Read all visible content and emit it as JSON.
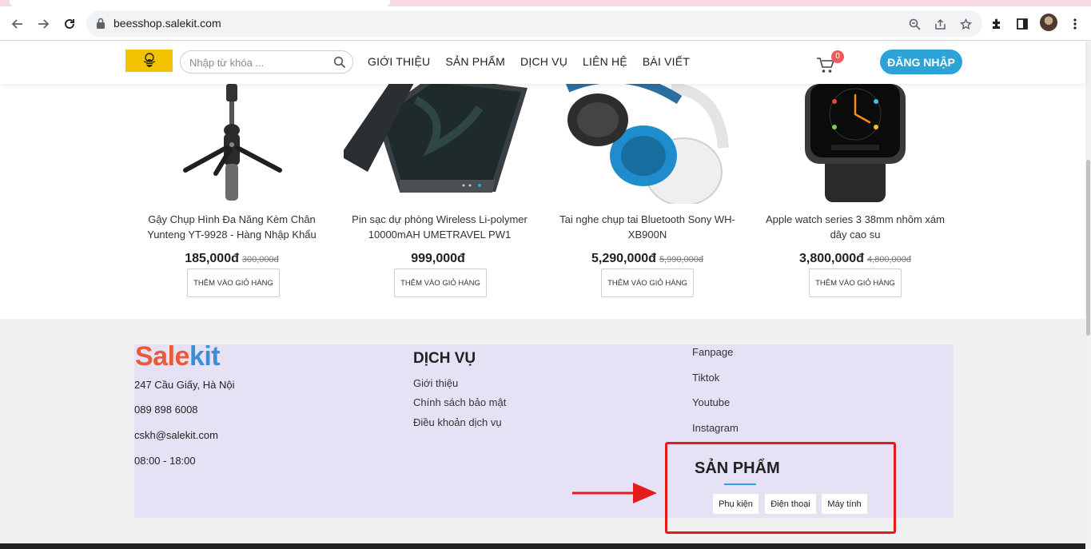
{
  "browser": {
    "url": "beesshop.salekit.com",
    "icons": [
      "back-icon",
      "forward-icon",
      "reload-icon",
      "lock-icon",
      "zoom-icon",
      "share-icon",
      "star-icon",
      "extensions-icon",
      "sidepanel-icon",
      "profile-avatar",
      "more-icon"
    ]
  },
  "header": {
    "search_placeholder": "Nhập từ khóa ...",
    "menu": [
      "GIỚI THIỆU",
      "SẢN PHẨM",
      "DỊCH VỤ",
      "LIÊN HỆ",
      "BÀI VIẾT"
    ],
    "cart_count": "0",
    "login_label": "ĐĂNG NHẬP",
    "colors": {
      "logo_bg": "#f3c200",
      "accent": "#2ba3d6",
      "badge": "#ef5b5b"
    }
  },
  "products": [
    {
      "name": "Gậy Chụp Hình Đa Năng Kèm Chân Yunteng YT-9928 - Hàng Nhập Khẩu",
      "price": "185,000đ",
      "old_price": "300,000đ",
      "button": "THÊM VÀO GIỎ HÀNG"
    },
    {
      "name": "Pin sạc dự phòng Wireless Li-polymer 10000mAH UMETRAVEL PW1",
      "price": "999,000đ",
      "old_price": "",
      "button": "THÊM VÀO GIỎ HÀNG"
    },
    {
      "name": "Tai nghe chụp tai Bluetooth Sony WH-XB900N",
      "price": "5,290,000đ",
      "old_price": "5,990,000đ",
      "button": "THÊM VÀO GIỎ HÀNG"
    },
    {
      "name": "Apple watch series 3 38mm nhôm xám dây cao su",
      "price": "3,800,000đ",
      "old_price": "4,800,000đ",
      "button": "THÊM VÀO GIỎ HÀNG"
    }
  ],
  "footer": {
    "logo_text_1": "Sale",
    "logo_text_2": "kit",
    "contact": [
      "247 Cầu Giấy, Hà Nội",
      "089 898 6008",
      "cskh@salekit.com",
      "08:00 - 18:00"
    ],
    "services_title": "DỊCH VỤ",
    "services": [
      "Giới thiệu",
      "Chính sách bảo mật",
      "Điều khoản dịch vụ"
    ],
    "social": [
      "Fanpage",
      "Tiktok",
      "Youtube",
      "Instagram"
    ],
    "products_title": "SẢN PHẨM",
    "product_tags": [
      "Phụ kiện",
      "Điện thoại",
      "Máy tính"
    ],
    "highlight_color": "#e51b1b"
  }
}
